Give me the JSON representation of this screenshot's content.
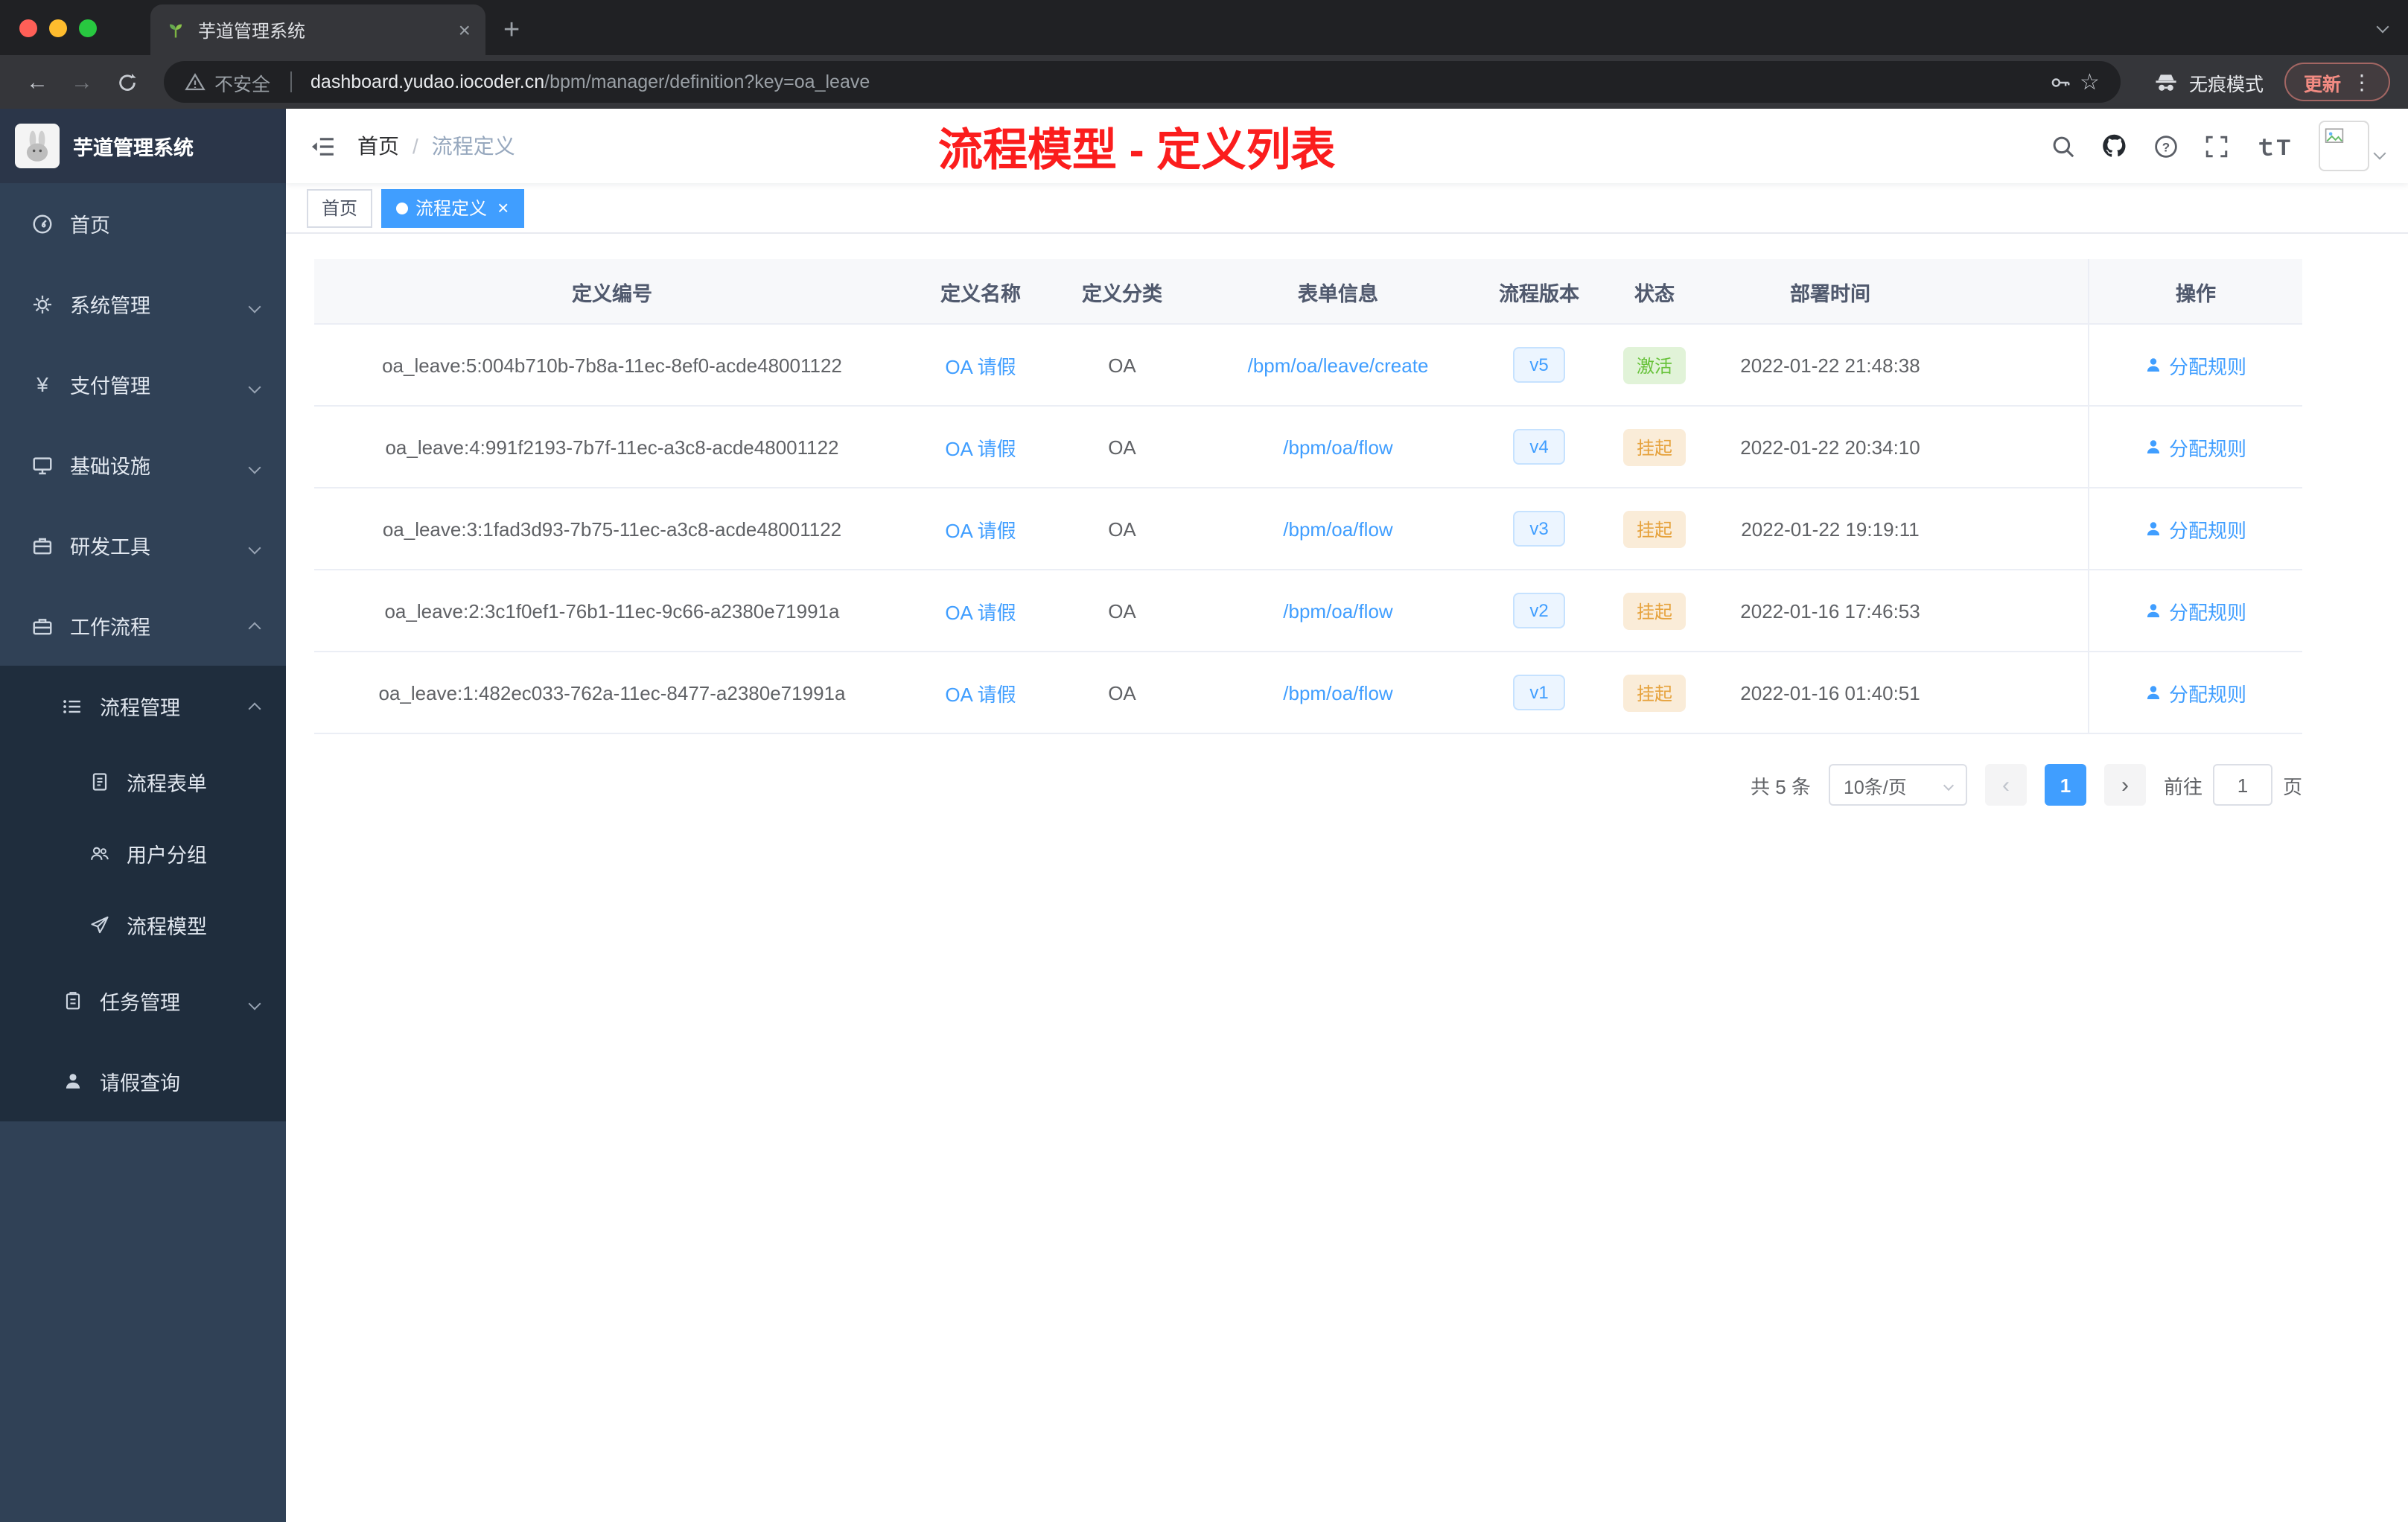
{
  "colors": {
    "accent": "#409eff",
    "success": "#67c23a",
    "warning": "#e6a23c",
    "annotation_red": "#fb1d1d"
  },
  "browser": {
    "tab_title": "芋道管理系统",
    "security_label": "不安全",
    "url_domain": "dashboard.yudao.iocoder.cn",
    "url_path": "/bpm/manager/definition?key=oa_leave",
    "incognito_label": "无痕模式",
    "update_label": "更新"
  },
  "sidebar": {
    "logo_title": "芋道管理系统",
    "items": [
      {
        "label": "首页"
      },
      {
        "label": "系统管理"
      },
      {
        "label": "支付管理"
      },
      {
        "label": "基础设施"
      },
      {
        "label": "研发工具"
      },
      {
        "label": "工作流程"
      },
      {
        "label": "流程管理"
      },
      {
        "label": "流程表单"
      },
      {
        "label": "用户分组"
      },
      {
        "label": "流程模型"
      },
      {
        "label": "任务管理"
      },
      {
        "label": "请假查询"
      }
    ]
  },
  "navbar": {
    "breadcrumb_home": "首页",
    "breadcrumb_sep": "/",
    "breadcrumb_current": "流程定义",
    "annotation": "流程模型 - 定义列表"
  },
  "tags": [
    {
      "label": "首页",
      "active": false
    },
    {
      "label": "流程定义",
      "active": true,
      "close": "×"
    }
  ],
  "table": {
    "columns": [
      "定义编号",
      "定义名称",
      "定义分类",
      "表单信息",
      "流程版本",
      "状态",
      "部署时间",
      "",
      "操作"
    ],
    "rows": [
      {
        "id": "oa_leave:5:004b710b-7b8a-11ec-8ef0-acde48001122",
        "name": "OA 请假",
        "category": "OA",
        "form": "/bpm/oa/leave/create",
        "version": "v5",
        "status": "激活",
        "status_type": "success",
        "time": "2022-01-22 21:48:38",
        "action": "分配规则"
      },
      {
        "id": "oa_leave:4:991f2193-7b7f-11ec-a3c8-acde48001122",
        "name": "OA 请假",
        "category": "OA",
        "form": "/bpm/oa/flow",
        "version": "v4",
        "status": "挂起",
        "status_type": "warning",
        "time": "2022-01-22 20:34:10",
        "action": "分配规则"
      },
      {
        "id": "oa_leave:3:1fad3d93-7b75-11ec-a3c8-acde48001122",
        "name": "OA 请假",
        "category": "OA",
        "form": "/bpm/oa/flow",
        "version": "v3",
        "status": "挂起",
        "status_type": "warning",
        "time": "2022-01-22 19:19:11",
        "action": "分配规则"
      },
      {
        "id": "oa_leave:2:3c1f0ef1-76b1-11ec-9c66-a2380e71991a",
        "name": "OA 请假",
        "category": "OA",
        "form": "/bpm/oa/flow",
        "version": "v2",
        "status": "挂起",
        "status_type": "warning",
        "time": "2022-01-16 17:46:53",
        "action": "分配规则"
      },
      {
        "id": "oa_leave:1:482ec033-762a-11ec-8477-a2380e71991a",
        "name": "OA 请假",
        "category": "OA",
        "form": "/bpm/oa/flow",
        "version": "v1",
        "status": "挂起",
        "status_type": "warning",
        "time": "2022-01-16 01:40:51",
        "action": "分配规则"
      }
    ]
  },
  "pagination": {
    "total": "共 5 条",
    "page_size": "10条/页",
    "prev": "‹",
    "page": "1",
    "next": "›",
    "goto_label": "前往",
    "goto_value": "1",
    "unit": "页"
  }
}
